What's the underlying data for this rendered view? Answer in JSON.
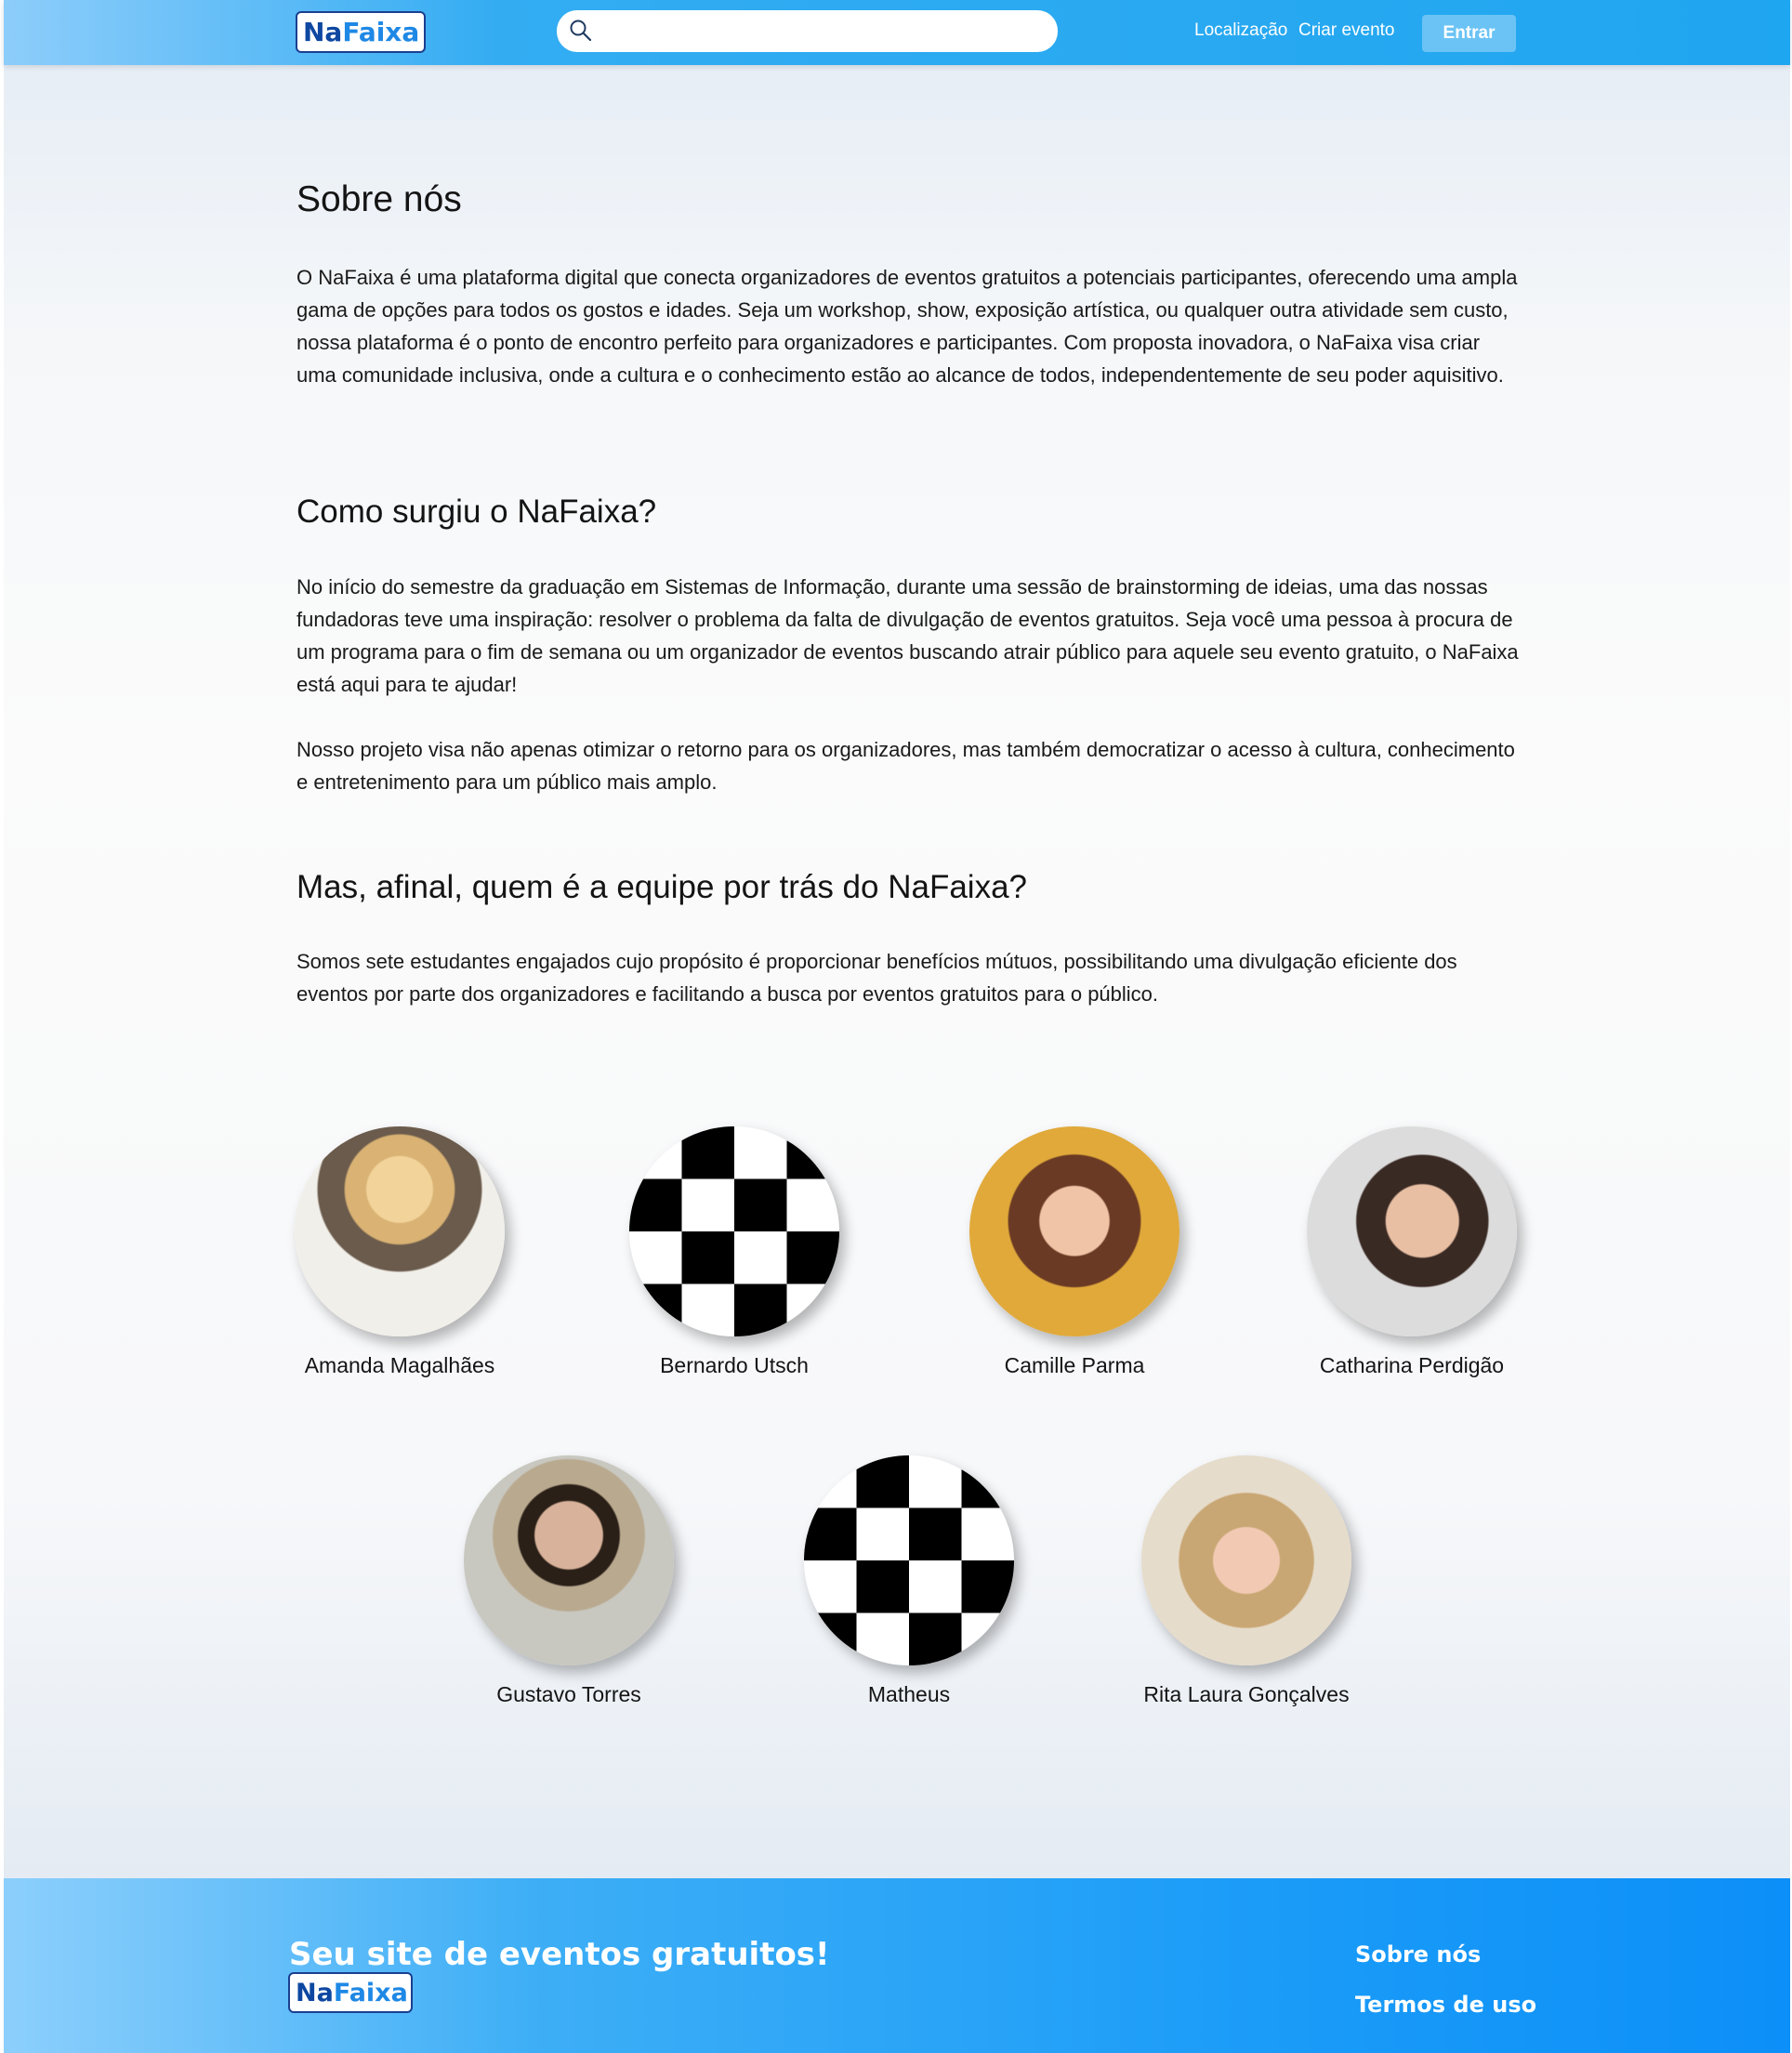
{
  "header": {
    "logo": {
      "part1": "Na",
      "part2": "Faixa"
    },
    "search": {
      "placeholder": ""
    },
    "nav": {
      "location": "Localização",
      "create_event": "Criar evento"
    },
    "login_label": "Entrar"
  },
  "about": {
    "title": "Sobre nós",
    "intro": "O NaFaixa é uma plataforma digital que conecta organizadores de eventos gratuitos a potenciais participantes, oferecendo uma ampla gama de opções para todos os gostos e idades. Seja um workshop, show, exposição artística, ou qualquer outra atividade sem custo, nossa plataforma é o ponto de encontro perfeito para organizadores e participantes. Com proposta inovadora, o NaFaixa visa criar uma comunidade inclusiva, onde a cultura e o conhecimento estão ao alcance de todos, independentemente de seu poder aquisitivo.",
    "origin_title": "Como surgiu o NaFaixa?",
    "origin_p1": "No início do semestre da graduação em Sistemas de Informação, durante uma sessão de brainstorming de ideias, uma das nossas fundadoras teve uma inspiração: resolver o problema da falta de divulgação de eventos gratuitos. Seja você uma pessoa à procura de um programa para o fim de semana ou um organizador de eventos buscando atrair público para aquele seu evento gratuito, o NaFaixa está aqui para te ajudar!",
    "origin_p2": "Nosso projeto visa não apenas otimizar o retorno para os organizadores, mas também democratizar o acesso à cultura, conhecimento e entretenimento para um público mais amplo.",
    "team_title": "Mas, afinal, quem é a equipe por trás do NaFaixa?",
    "team_text": "Somos sete estudantes engajados cujo propósito é proporcionar benefícios mútuos, possibilitando uma divulgação eficiente dos eventos por parte dos organizadores e facilitando a busca por eventos gratuitos para o público."
  },
  "team": [
    {
      "name": "Amanda Magalhães",
      "photo": "portrait"
    },
    {
      "name": "Bernardo Utsch",
      "photo": "checkerboard-placeholder"
    },
    {
      "name": "Camille Parma",
      "photo": "portrait"
    },
    {
      "name": "Catharina Perdigão",
      "photo": "portrait"
    },
    {
      "name": "Gustavo Torres",
      "photo": "portrait"
    },
    {
      "name": "Matheus",
      "photo": "checkerboard-placeholder"
    },
    {
      "name": "Rita Laura Gonçalves",
      "photo": "portrait"
    }
  ],
  "footer": {
    "tagline": "Seu site de eventos gratuitos!",
    "logo": {
      "part1": "Na",
      "part2": "Faixa"
    },
    "links": {
      "about": "Sobre nós",
      "terms": "Termos de uso"
    }
  },
  "colors": {
    "header_blue": "#1fa6f0",
    "footer_blue": "#0c8ff8",
    "logo_dark": "#0d47a1",
    "logo_light": "#1e88e5",
    "button_light_blue": "#6bc3f5"
  }
}
